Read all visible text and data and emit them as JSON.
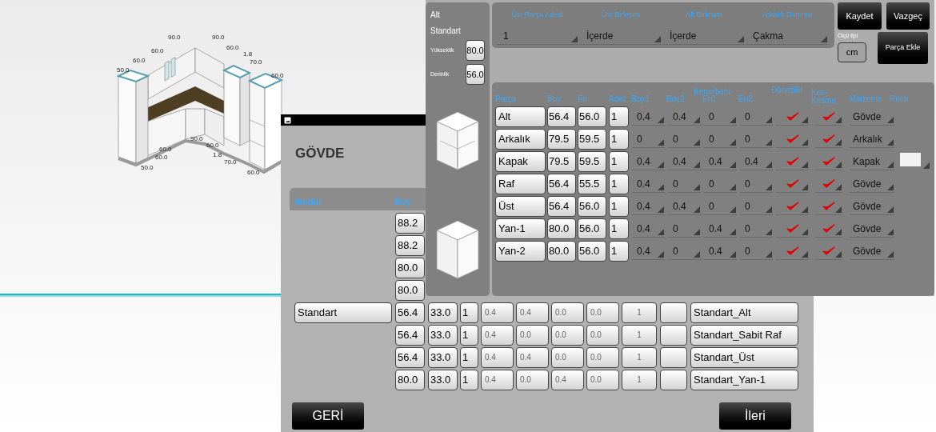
{
  "background": {
    "dimension_labels": [
      "90.0",
      "90.0",
      "60.0",
      "60.0",
      "1.8",
      "60.0",
      "70.0",
      "50.0",
      "60.0",
      "90.0",
      "60.0",
      "60.0",
      "1.8",
      "60.0",
      "70.0",
      "50.0",
      "60.0"
    ]
  },
  "dialog": {
    "title": "GÖVDE",
    "columns": [
      "Modül",
      "Boy"
    ],
    "boy_values": [
      "88.2",
      "88.2",
      "80.0",
      "80.0"
    ],
    "rows": [
      {
        "module": "Standart",
        "boy": "56.4",
        "col_3": "33.0",
        "col_4": "1",
        "values": [
          "0.4",
          "0.4",
          "0.0",
          "0.0"
        ],
        "col_9": "1",
        "name": "Standart_Alt"
      },
      {
        "boy": "56.4",
        "col_3": "33.0",
        "col_4": "1",
        "values": [
          "0.4",
          "0.0",
          "0.0",
          "0.0"
        ],
        "col_9": "1",
        "name": "Standart_Sabit Raf"
      },
      {
        "boy": "56.4",
        "col_3": "33.0",
        "col_4": "1",
        "values": [
          "0.4",
          "0.4",
          "0.0",
          "0.0"
        ],
        "col_9": "1",
        "name": "Standart_Üst"
      },
      {
        "boy": "80.0",
        "col_3": "33.0",
        "col_4": "1",
        "values": [
          "0.4",
          "0.0",
          "0.4",
          "0.0"
        ],
        "col_9": "1",
        "name": "Standart_Yan-1"
      }
    ],
    "back": "GERİ",
    "next": "İleri"
  },
  "overlay": {
    "summary": {
      "type": "Alt",
      "name": "Standart",
      "fields": [
        {
          "label": "Yükseklik",
          "value": "80.0"
        },
        {
          "label": "Derinlik",
          "value": "56.0"
        }
      ]
    },
    "options": [
      {
        "label": "Üst Parça Adedi",
        "value": "1"
      },
      {
        "label": "Üst Birleşim",
        "value": "İçerde"
      },
      {
        "label": "Alt Birleşim",
        "value": "İçerde"
      },
      {
        "label": "Arkalık Durumu",
        "value": "Çakma"
      }
    ],
    "save": "Kaydet",
    "cancel": "Vazgeç",
    "unit": {
      "label": "Ölçü tipi",
      "value": "cm"
    },
    "add_part": "Parça Ekle",
    "parts_table": {
      "group_header": "Kenarbant",
      "columns": [
        "Parça",
        "Boy",
        "En",
        "Adet",
        "Boy1",
        "Boy2",
        "En1",
        "En2",
        "Dönebilir",
        "Kes-Kesme",
        "Malzeme",
        "Renk"
      ],
      "rows": [
        {
          "part": "Alt",
          "boy": "56.4",
          "en": "56.0",
          "adet": "1",
          "edges": [
            "0.4",
            "0.4",
            "0",
            "0"
          ],
          "rotatable": true,
          "cut": true,
          "material": "Gövde",
          "color_swatch": false
        },
        {
          "part": "Arkalık",
          "boy": "79.5",
          "en": "59.5",
          "adet": "1",
          "edges": [
            "0",
            "0",
            "0",
            "0"
          ],
          "rotatable": true,
          "cut": true,
          "material": "Arkalık",
          "color_swatch": false
        },
        {
          "part": "Kapak",
          "boy": "79.5",
          "en": "59.5",
          "adet": "1",
          "edges": [
            "0.4",
            "0.4",
            "0.4",
            "0.4"
          ],
          "rotatable": true,
          "cut": true,
          "material": "Kapak",
          "color_swatch": true
        },
        {
          "part": "Raf",
          "boy": "56.4",
          "en": "55.5",
          "adet": "1",
          "edges": [
            "0.4",
            "0",
            "0",
            "0"
          ],
          "rotatable": true,
          "cut": true,
          "material": "Gövde",
          "color_swatch": false
        },
        {
          "part": "Üst",
          "boy": "56.4",
          "en": "56.0",
          "adet": "1",
          "edges": [
            "0.4",
            "0.4",
            "0",
            "0"
          ],
          "rotatable": true,
          "cut": true,
          "material": "Gövde",
          "color_swatch": false
        },
        {
          "part": "Yan-1",
          "boy": "80.0",
          "en": "56.0",
          "adet": "1",
          "edges": [
            "0.4",
            "0",
            "0.4",
            "0"
          ],
          "rotatable": true,
          "cut": true,
          "material": "Gövde",
          "color_swatch": false
        },
        {
          "part": "Yan-2",
          "boy": "80.0",
          "en": "56.0",
          "adet": "1",
          "edges": [
            "0.4",
            "0",
            "0.4",
            "0"
          ],
          "rotatable": true,
          "cut": true,
          "material": "Gövde",
          "color_swatch": false
        }
      ]
    }
  }
}
